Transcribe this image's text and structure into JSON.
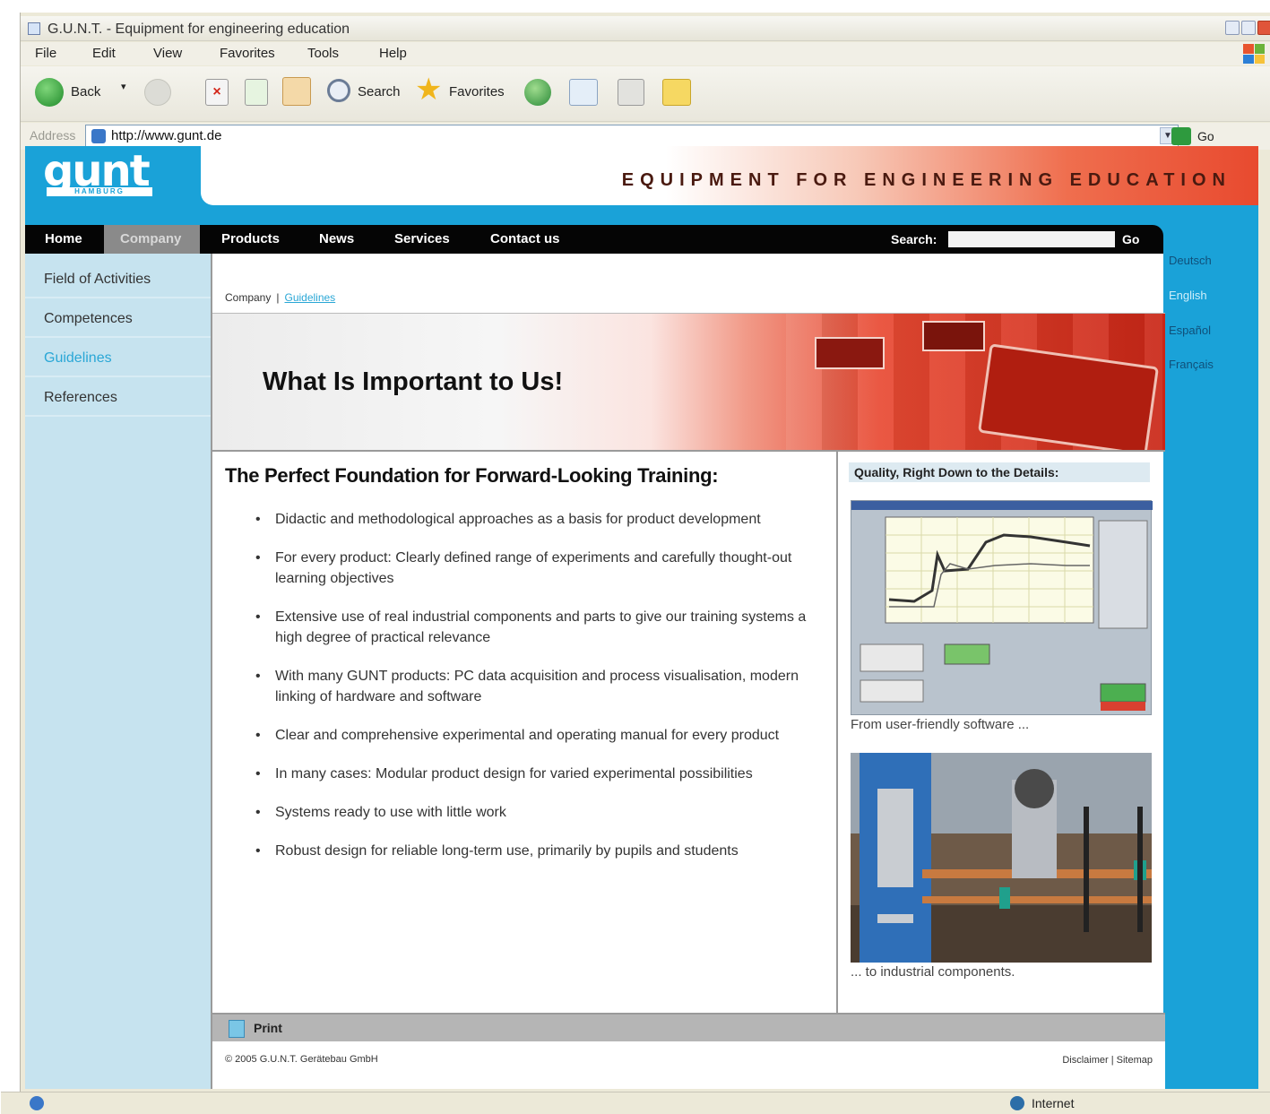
{
  "window": {
    "title": "G.U.N.T. - Equipment for engineering education"
  },
  "menu": [
    "File",
    "Edit",
    "View",
    "Favorites",
    "Tools",
    "Help"
  ],
  "toolbar": {
    "back": "Back",
    "search": "Search",
    "favorites": "Favorites"
  },
  "address": {
    "label": "Address",
    "url": "http://www.gunt.de",
    "go": "Go"
  },
  "site": {
    "logo": "gunt",
    "logo_sub": "HAMBURG",
    "tagline": "EQUIPMENT FOR ENGINEERING EDUCATION",
    "colors": {
      "brand_blue": "#1aa2d8",
      "banner_red": "#e84a2f"
    }
  },
  "nav": {
    "items": [
      "Home",
      "Company",
      "Products",
      "News",
      "Services",
      "Contact us"
    ],
    "active": "Company",
    "search_label": "Search:",
    "search_value": "",
    "search_go": "Go"
  },
  "sidebar": {
    "items": [
      "Field of Activities",
      "Competences",
      "Guidelines",
      "References"
    ],
    "active": "Guidelines"
  },
  "languages": [
    "Deutsch",
    "English",
    "Español",
    "Français"
  ],
  "breadcrumb": {
    "parent": "Company",
    "separator": "|",
    "current": "Guidelines"
  },
  "hero": {
    "title": "What Is Important to Us!"
  },
  "main": {
    "heading": "The Perfect Foundation for Forward-Looking Training:",
    "bullets": [
      "Didactic and methodological approaches as a basis for product development",
      "For every product: Clearly defined range of experiments and carefully thought-out learning objectives",
      "Extensive use of real industrial components and parts to give our training systems a high degree of practical relevance",
      "With many GUNT products: PC data acquisition and process visualisation, modern linking of hardware and software",
      "Clear and comprehensive experimental and operating manual for every product",
      "In many cases: Modular product design for varied experimental possibilities",
      "Systems ready to use with little work",
      "Robust design for reliable long-term use, primarily by pupils and students"
    ]
  },
  "side": {
    "heading": "Quality, Right Down to the Details:",
    "caption_software": "From user-friendly software ...",
    "caption_industrial": "... to industrial components."
  },
  "printbar": {
    "label": "Print"
  },
  "footer": {
    "copyright": "© 2005 G.U.N.T. Gerätebau GmbH",
    "links": "Disclaimer | Sitemap"
  },
  "status": {
    "zone": "Internet"
  }
}
